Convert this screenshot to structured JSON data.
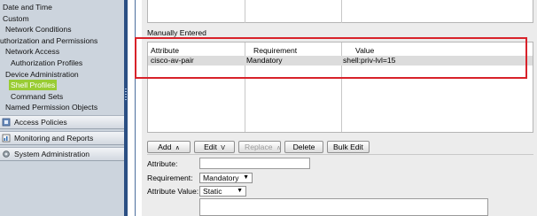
{
  "nav": {
    "tree": [
      {
        "label": "Date and Time",
        "indent": 0
      },
      {
        "label": "Custom",
        "indent": 0
      },
      {
        "label": "Network Conditions",
        "indent": 1
      },
      {
        "label": "uthorization and Permissions",
        "indent": 0
      },
      {
        "label": "Network Access",
        "indent": 1
      },
      {
        "label": "Authorization Profiles",
        "indent": 2
      },
      {
        "label": "Device Administration",
        "indent": 1
      },
      {
        "label": "Shell Profiles",
        "indent": 2,
        "selected": true
      },
      {
        "label": "Command Sets",
        "indent": 2
      },
      {
        "label": "Named Permission Objects",
        "indent": 1
      }
    ],
    "sections": [
      {
        "label": "Access Policies",
        "icon": "access-policies-icon"
      },
      {
        "label": "Monitoring and Reports",
        "icon": "monitoring-reports-icon"
      },
      {
        "label": "System Administration",
        "icon": "system-administration-icon"
      }
    ],
    "selected_color": "#99cc33"
  },
  "main": {
    "section_title": "Manually Entered",
    "table": {
      "columns": [
        "Attribute",
        "Requirement",
        "Value"
      ],
      "rows": [
        {
          "attribute": "cisco-av-pair",
          "requirement": "Mandatory",
          "value": "shell:priv-lvl=15"
        }
      ]
    },
    "toolbar": {
      "add": "Add",
      "add_caret": "∧",
      "edit": "Edit",
      "edit_caret": "V",
      "replace": "Replace",
      "replace_caret": "∧",
      "delete": "Delete",
      "bulk_edit": "Bulk Edit"
    },
    "form": {
      "attribute_label": "Attribute:",
      "attribute_value": "",
      "requirement_label": "Requirement:",
      "requirement_value": "Mandatory",
      "attribute_value_label": "Attribute Value:",
      "attribute_value_type": "Static",
      "value_text": ""
    }
  },
  "annotation_color": "#d8222a"
}
